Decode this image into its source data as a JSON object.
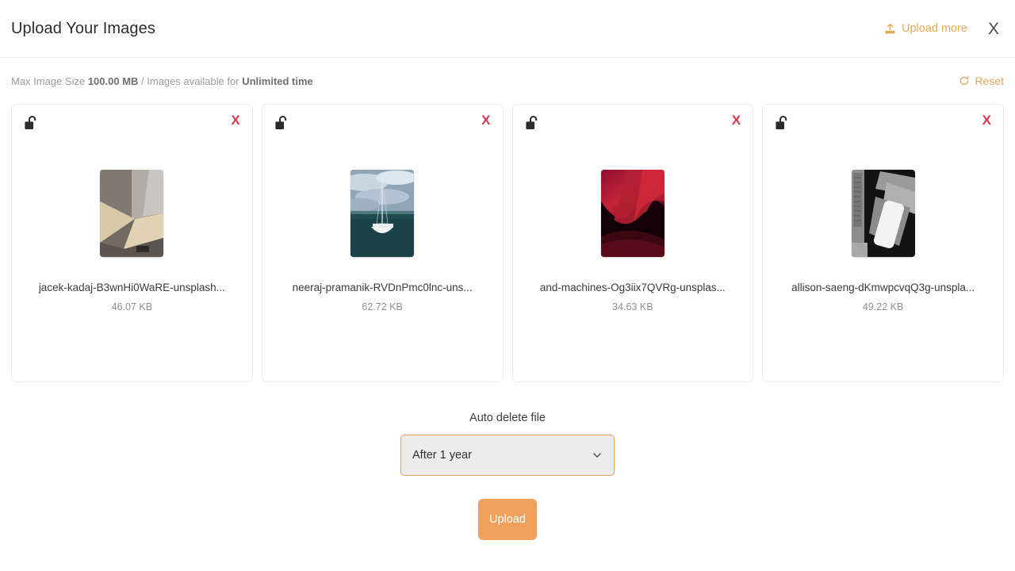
{
  "header": {
    "title": "Upload Your Images",
    "upload_more_label": "Upload more",
    "upload_more_icon": "upload-icon",
    "close_label": "X",
    "accent_color": "#e8a857"
  },
  "infobar": {
    "prefix": "Max Image Size ",
    "max_size": "100.00 MB",
    "middle": " / Images available for ",
    "availability": "Unlimited time",
    "reset_label": "Reset",
    "reset_icon": "refresh-icon",
    "reset_color": "#e0a45e"
  },
  "cards": [
    {
      "lock_icon": "unlock-icon",
      "remove_label": "X",
      "filename": "jacek-kadaj-B3wnHi0WaRE-unsplash...",
      "filesize": "46.07 KB",
      "thumb": "grey-tan-geometric-photo"
    },
    {
      "lock_icon": "unlock-icon",
      "remove_label": "X",
      "filename": "neeraj-pramanik-RVDnPmc0lnc-uns...",
      "filesize": "62.72 KB",
      "thumb": "sailboat-ocean-photo"
    },
    {
      "lock_icon": "unlock-icon",
      "remove_label": "X",
      "filename": "and-machines-Og3iix7QVRg-unsplas...",
      "filesize": "34.63 KB",
      "thumb": "dark-red-abstract-wave"
    },
    {
      "lock_icon": "unlock-icon",
      "remove_label": "X",
      "filename": "allison-saeng-dKmwpcvqQ3g-unspla...",
      "filesize": "49.22 KB",
      "thumb": "greyscale-phone-photo"
    }
  ],
  "bottom": {
    "autodelete_label": "Auto delete file",
    "autodelete_value": "After 1 year",
    "caret_icon": "chevron-down-icon",
    "upload_button_label": "Upload",
    "upload_button_color": "#f0a05a"
  }
}
